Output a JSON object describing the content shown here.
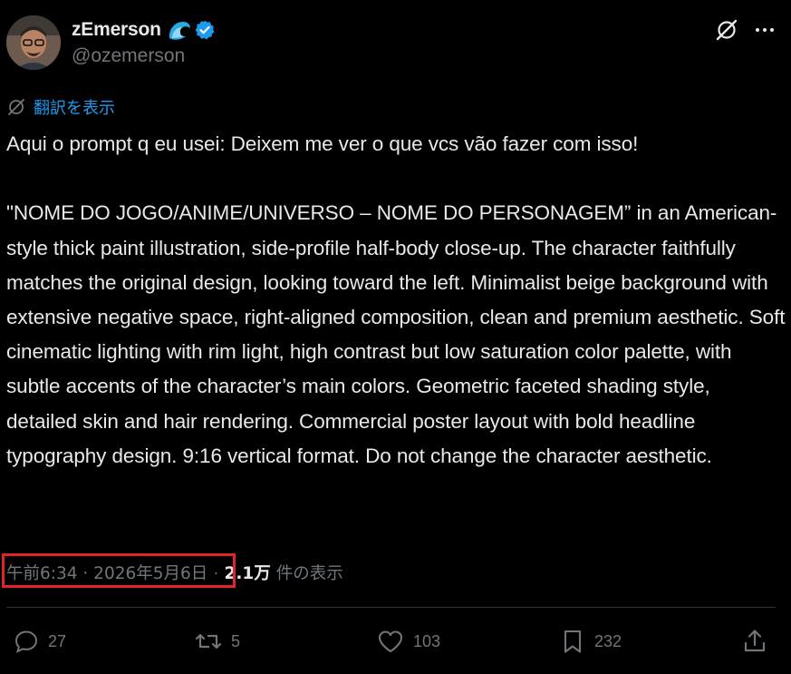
{
  "author": {
    "display_name": "zEmerson",
    "handle": "@ozemerson",
    "avatar_icon": "avatar-photo",
    "badges": [
      "wave-badge-icon",
      "verified-badge-icon"
    ],
    "verified_color": "#1d9bf0"
  },
  "header_actions": {
    "grok_icon": "grok-icon",
    "more_icon": "more-icon"
  },
  "translate": {
    "icon": "translate-icon",
    "label": "翻訳を表示"
  },
  "tweet": {
    "text": "Aqui o prompt q eu usei: Deixem me ver o que vcs vão fazer com isso!\n\n\"NOME DO JOGO/ANIME/UNIVERSO – NOME DO PERSONAGEM” in an American-style thick paint illustration, side-profile half-body close-up. The character faithfully matches the original design, looking toward the left. Minimalist beige background with extensive negative space, right-aligned composition, clean and premium aesthetic. Soft cinematic lighting with rim light, high contrast but low saturation color palette, with subtle accents of the character’s main colors. Geometric faceted shading style, detailed skin and hair rendering. Commercial poster layout with bold headline typography design. 9:16 vertical format. Do not change the character aesthetic."
  },
  "meta": {
    "time": "午前6:34 · 2026年5月6日",
    "separator": "·",
    "views_count": "2.1万",
    "views_label": "件の表示"
  },
  "actions": {
    "reply": {
      "icon": "reply-icon",
      "count": "27"
    },
    "repost": {
      "icon": "repost-icon",
      "count": "5"
    },
    "like": {
      "icon": "heart-icon",
      "count": "103"
    },
    "bookmark": {
      "icon": "bookmark-icon",
      "count": "232"
    },
    "share": {
      "icon": "share-icon"
    }
  },
  "colors": {
    "background": "#000000",
    "text": "#e7e9ea",
    "muted": "#71767b",
    "link": "#1d9bf0",
    "divider": "#2f3336",
    "highlight": "#e0242c"
  }
}
